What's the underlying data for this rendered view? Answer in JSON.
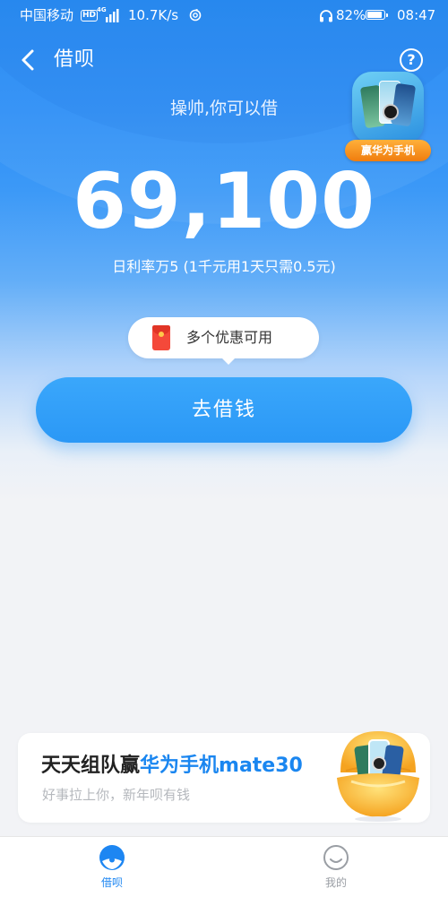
{
  "status_bar": {
    "carrier": "中国移动",
    "hd_badge": "HD",
    "network_type": "4G",
    "speed": "10.7K/s",
    "battery_percent": "82%",
    "time": "08:47"
  },
  "header": {
    "title": "借呗",
    "help_symbol": "?"
  },
  "promo_badge": {
    "label": "赢华为手机"
  },
  "hero": {
    "greeting": "操帅,你可以借",
    "amount": "69,100",
    "rate_text": "日利率万5 (1千元用1天只需0.5元)"
  },
  "coupon": {
    "text": "多个优惠可用"
  },
  "primary_button": {
    "label": "去借钱"
  },
  "bottom_card": {
    "title_prefix": "天天组队赢",
    "title_highlight": "华为手机mate30",
    "subtitle": "好事拉上你，新年呗有钱"
  },
  "tab_bar": {
    "tabs": [
      {
        "label": "借呗",
        "icon": "jiebei-logo-icon",
        "active": true
      },
      {
        "label": "我的",
        "icon": "smiley-face-icon",
        "active": false
      }
    ]
  },
  "colors": {
    "primary_blue": "#1d86f2",
    "button_blue": "#2b98f6",
    "highlight_blue": "#1a86f0",
    "coupon_red": "#f4493a",
    "promo_orange": "#f07d0e",
    "inactive_gray": "#9a9ea4"
  }
}
